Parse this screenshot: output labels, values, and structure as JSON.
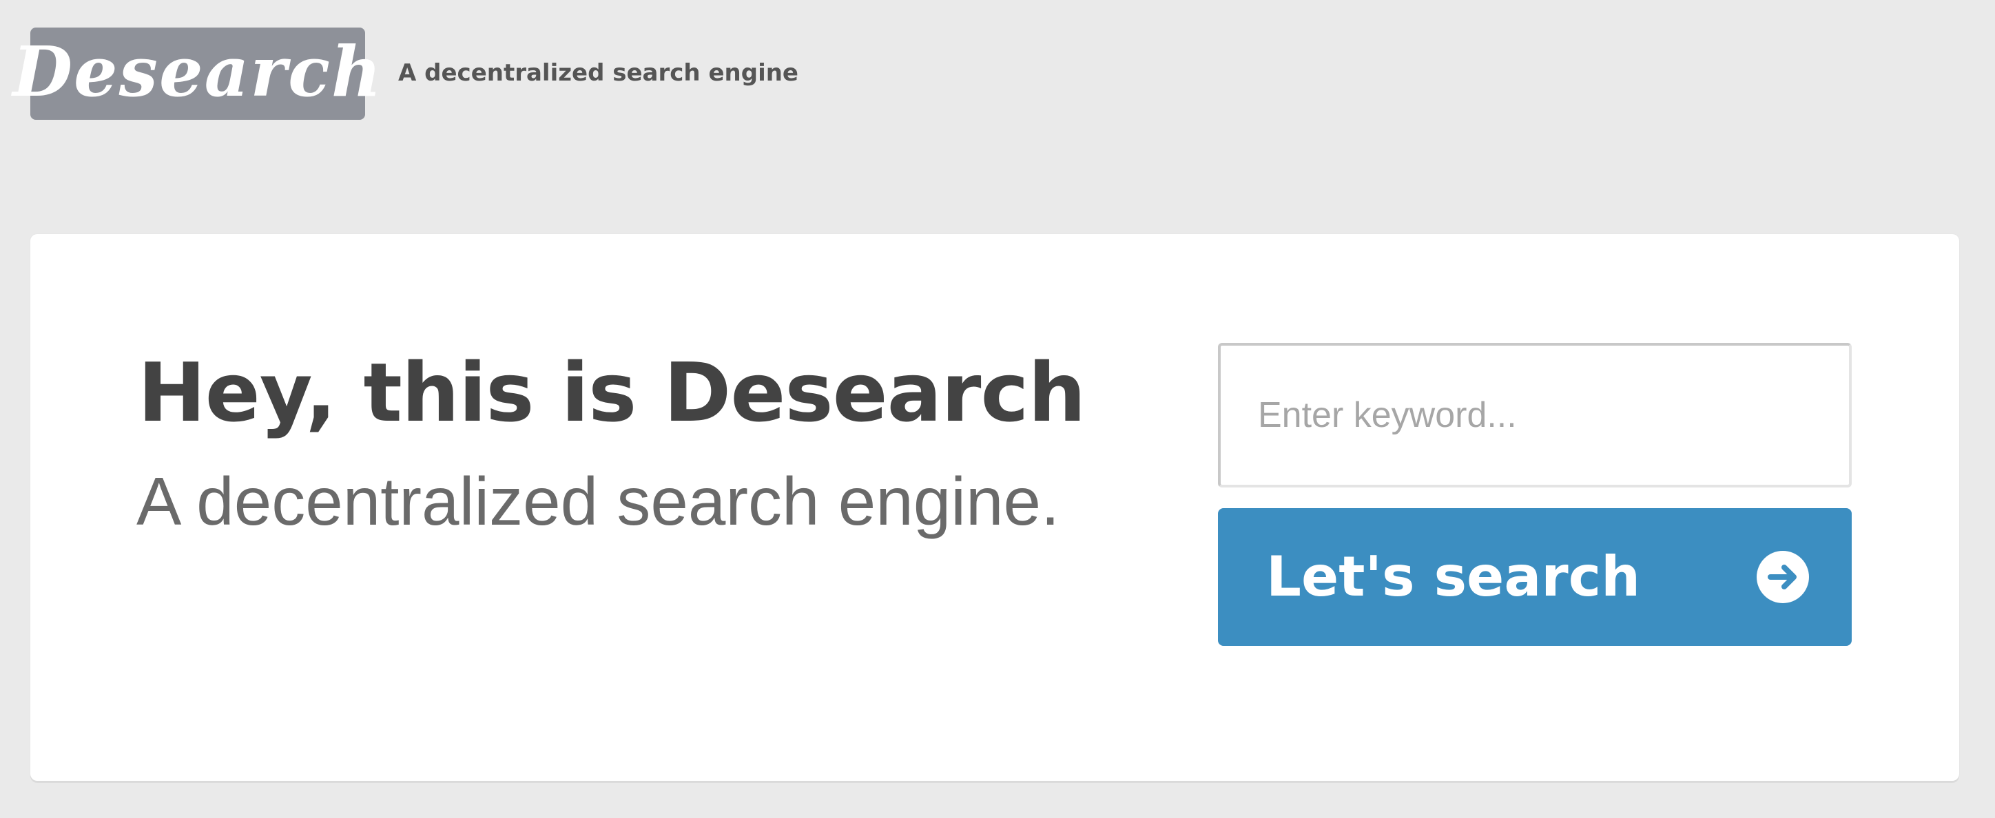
{
  "header": {
    "logo_text": "Desearch",
    "tagline": "A decentralized search engine"
  },
  "hero": {
    "headline": "Hey, this is Desearch",
    "subheadline": "A decentralized search engine."
  },
  "search": {
    "placeholder": "Enter keyword...",
    "value": "",
    "button_label": "Let's search",
    "button_icon": "arrow-right-circle-icon"
  },
  "colors": {
    "background": "#eaeaea",
    "logo_bg": "#8e9199",
    "button_bg": "#3c8ec1",
    "headline_text": "#434343",
    "subheadline_text": "#6a6a6a"
  }
}
